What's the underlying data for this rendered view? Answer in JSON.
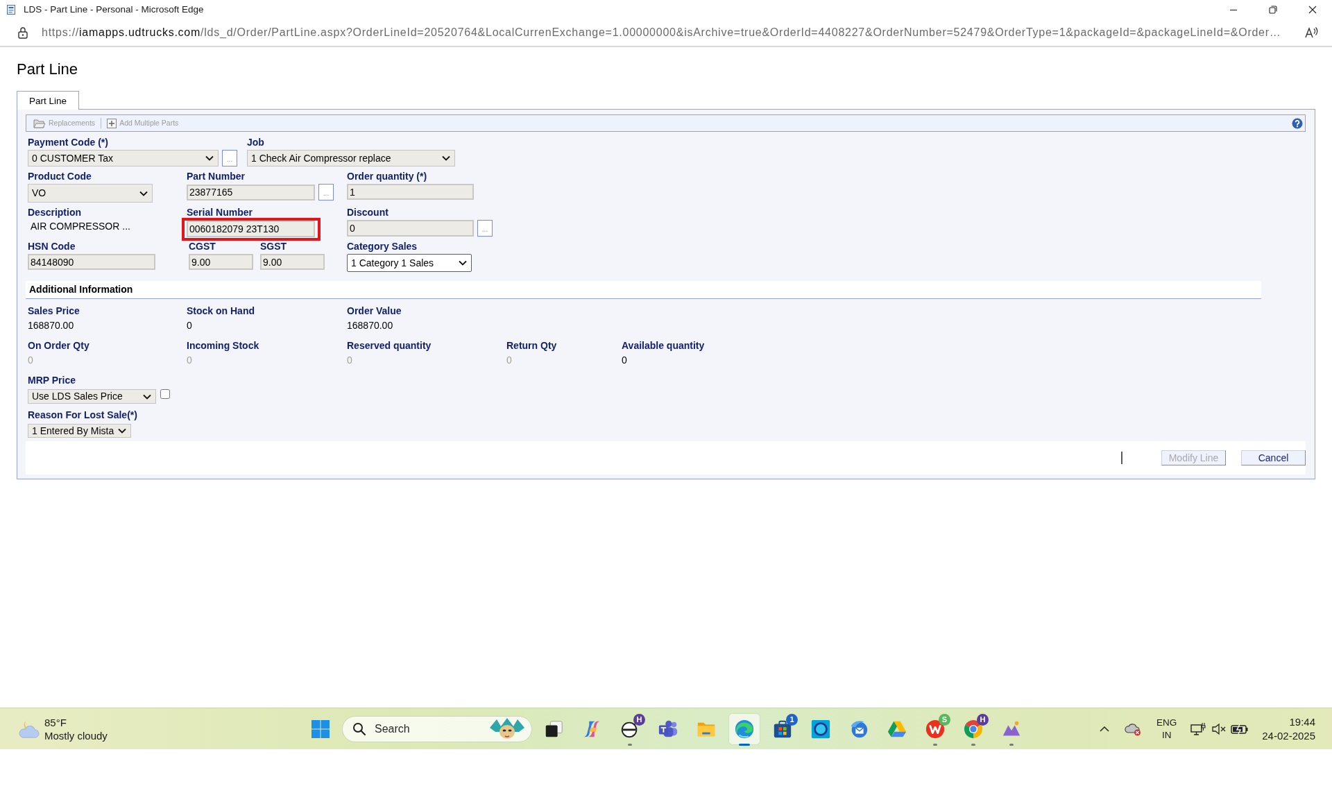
{
  "window": {
    "title": "LDS - Part Line - Personal - Microsoft Edge"
  },
  "address_bar": {
    "scheme": "https://",
    "host": "iamapps.udtrucks.com",
    "path": "/lds_d/Order/PartLine.aspx?OrderLineId=20520764&LocalCurrenExchange=1.00000000&isArchive=true&OrderId=4408227&OrderNumber=52479&OrderType=1&packageId=&packageLineId=&Order…"
  },
  "page": {
    "heading": "Part Line"
  },
  "tabs": [
    {
      "label": "Part Line",
      "selected": true
    }
  ],
  "toolbar": [
    {
      "kind": "folder",
      "label": "Replacements",
      "disabled": true
    },
    {
      "kind": "add",
      "label": "Add Multiple Parts",
      "disabled": true
    }
  ],
  "form": {
    "fields": [
      {
        "label": "Payment Code (*)",
        "kind": "select",
        "value": "0 CUSTOMER Tax",
        "disabled": true,
        "lookup": "..."
      },
      {
        "label": "Job",
        "kind": "select",
        "value": "1 Check Air Compressor replace",
        "disabled": true
      },
      {
        "label": "Product Code",
        "kind": "select",
        "value": "VO",
        "disabled": true
      },
      {
        "label": "Part Number",
        "kind": "input",
        "value": "23877165",
        "disabled": true,
        "lookup": "..."
      },
      {
        "label": "Order quantity (*)",
        "kind": "input",
        "value": "1",
        "disabled": true
      },
      {
        "label": "Description",
        "kind": "text",
        "value": "AIR COMPRESSOR ..."
      },
      {
        "label": "Serial Number",
        "kind": "input",
        "value": "0060182079 23T130",
        "disabled": true,
        "highlighted": true
      },
      {
        "label": "Discount",
        "kind": "input",
        "value": "0",
        "disabled": true,
        "lookup": "..."
      },
      {
        "label": "HSN Code",
        "kind": "input",
        "value": "84148090",
        "disabled": true
      },
      {
        "label": "CGST",
        "kind": "input",
        "value": "9.00",
        "disabled": true
      },
      {
        "label": "SGST",
        "kind": "input",
        "value": "9.00",
        "disabled": true
      },
      {
        "label": "Category Sales",
        "kind": "select",
        "value": "1 Category 1 Sales",
        "disabled": false
      }
    ]
  },
  "additional_info": {
    "heading": "Additional Information",
    "rows": [
      [
        {
          "label": "Sales Price",
          "value": "168870.00",
          "disabled": false
        },
        {
          "label": "Stock on Hand",
          "value": "0",
          "disabled": false
        },
        {
          "label": "Order Value",
          "value": "168870.00",
          "disabled": false
        }
      ],
      [
        {
          "label": "On Order Qty",
          "value": "0",
          "disabled": true
        },
        {
          "label": "Incoming Stock",
          "value": "0",
          "disabled": true
        },
        {
          "label": "Reserved quantity",
          "value": "0",
          "disabled": true
        },
        {
          "label": "Return Qty",
          "value": "0",
          "disabled": true
        },
        {
          "label": "Available quantity",
          "value": "0",
          "disabled": false
        }
      ]
    ]
  },
  "mrp_price": {
    "label": "MRP Price",
    "value": "Use LDS Sales Price",
    "disabled": true,
    "checked": false
  },
  "lost_sale_reason": {
    "label": "Reason For Lost Sale(*)",
    "value": "1 Entered By Mista",
    "disabled": true
  },
  "footer_buttons": [
    {
      "label": "Modify Line",
      "disabled": true
    },
    {
      "label": "Cancel",
      "disabled": false
    }
  ],
  "taskbar": {
    "weather": {
      "temperature": "85°F",
      "condition": "Mostly cloudy"
    },
    "search": {
      "placeholder": "Search"
    },
    "apps": [
      {
        "kind": "squares",
        "selected": false,
        "running": false
      },
      {
        "kind": "swirl",
        "selected": false,
        "running": false
      },
      {
        "kind": "roundel",
        "selected": false,
        "running": true,
        "badge": {
          "text": "H",
          "color": "#5b3c9f"
        }
      },
      {
        "kind": "people",
        "selected": false,
        "running": false
      },
      {
        "kind": "folder",
        "selected": false,
        "running": false
      },
      {
        "kind": "wave",
        "selected": true,
        "running": true
      },
      {
        "kind": "bag",
        "selected": false,
        "running": false,
        "badge": {
          "text": "1",
          "color": "#1f64c8"
        }
      },
      {
        "kind": "ring",
        "selected": false,
        "running": false
      },
      {
        "kind": "bird",
        "selected": false,
        "running": false
      },
      {
        "kind": "triangle",
        "selected": false,
        "running": false
      },
      {
        "kind": "wletter",
        "selected": false,
        "running": true,
        "badge": {
          "text": "S",
          "color": "#57b85c"
        }
      },
      {
        "kind": "sphere",
        "selected": false,
        "running": true,
        "badge": {
          "text": "H",
          "color": "#5b3c9f"
        }
      },
      {
        "kind": "peaks",
        "selected": false,
        "running": true
      }
    ],
    "tray": {
      "language": "ENG",
      "region": "IN"
    },
    "clock": {
      "time": "19:44",
      "date": "24-02-2025"
    }
  }
}
